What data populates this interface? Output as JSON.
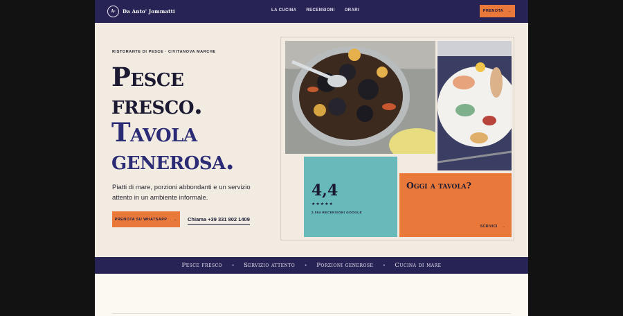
{
  "nav": {
    "logo_mark": "A·",
    "brand": "Da Anto' Jommatti",
    "links": [
      "LA CUCINA",
      "RECENSIONI",
      "ORARI"
    ],
    "cta_label": "PRENOTA",
    "cta_arrow": "→"
  },
  "hero": {
    "eyebrow": "RISTORANTE DI PESCE · CIVITANOVA MARCHE",
    "headline_dark": [
      "Pesce",
      "fresco."
    ],
    "headline_blue": [
      "Tavola",
      "generosa."
    ],
    "lede": "Piatti di mare, porzioni abbondanti e un servizio attento in un ambiente informale.",
    "whatsapp_label": "PRENOTA SU WHATSAPP",
    "whatsapp_arrow": "→",
    "call_label": "Chiama +39 331 802 1409"
  },
  "rating": {
    "value": "4,4",
    "stars": "★★★★★",
    "reviews": "2.094 RECENSIONI GOOGLE"
  },
  "cta_card": {
    "title": "Oggi a tavola?",
    "link_label": "SCRIVICI",
    "link_arrow": "→"
  },
  "marquee": [
    "Pesce fresco",
    "Servizio attento",
    "Porzioni generose",
    "Cucina di mare"
  ],
  "colors": {
    "navy": "#272455",
    "orange": "#e9793a",
    "teal": "#68b9b9",
    "cream": "#f1ebe1"
  }
}
